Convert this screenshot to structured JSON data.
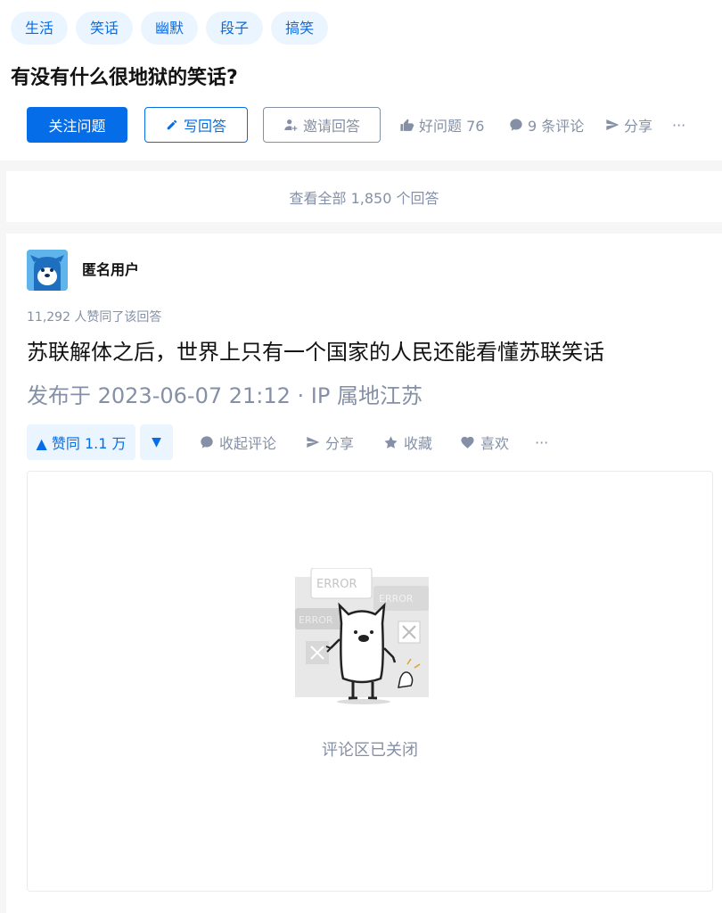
{
  "topics": [
    "生活",
    "笑话",
    "幽默",
    "段子",
    "搞笑"
  ],
  "question": {
    "title": "有没有什么很地狱的笑话?",
    "follow_label": "关注问题",
    "write_label": "写回答",
    "invite_label": "邀请回答",
    "good_question_label": "好问题 76",
    "comments_label": "9 条评论",
    "share_label": "分享",
    "more_label": "···"
  },
  "view_all_label": "查看全部 1,850 个回答",
  "answer": {
    "author": "匿名用户",
    "votes_text": "11,292 人赞同了该回答",
    "content": "苏联解体之后，世界上只有一个国家的人民还能看懂苏联笑话",
    "published": "发布于 2023-06-07 21:12 · IP 属地江苏",
    "upvote_label": "▲ 赞同 1.1 万",
    "downvote_label": "▼",
    "collapse_comments_label": "收起评论",
    "share_label": "分享",
    "collect_label": "收藏",
    "like_label": "喜欢",
    "more_label": "···"
  },
  "comments_closed_text": "评论区已关闭",
  "illustration": {
    "error_labels": [
      "ERROR",
      "ERROR",
      "ERROR"
    ]
  },
  "colors": {
    "brand": "#056de8",
    "muted": "#8590a6",
    "topic_bg": "#ebf5ff"
  }
}
